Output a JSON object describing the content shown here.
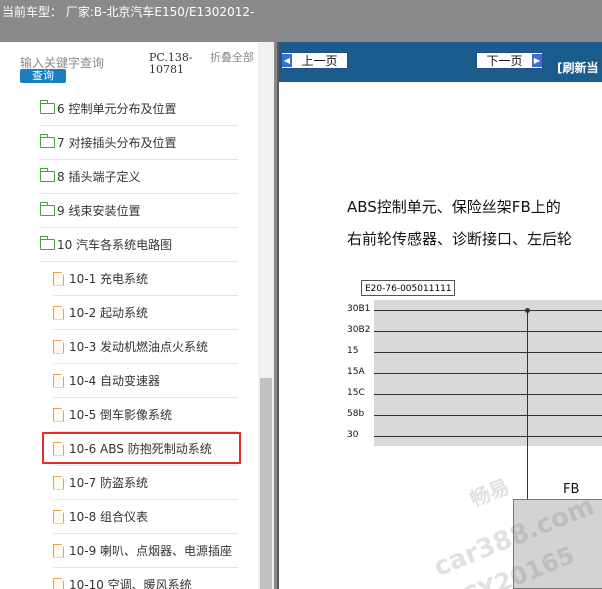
{
  "header": {
    "title": "当前车型： 厂家:B-北京汽车E150/E1302012-"
  },
  "sidebar": {
    "search_placeholder": "输入关键字查询",
    "search_button": "查询",
    "pc_code": "PC.138-10781",
    "collapse_all": "折叠全部",
    "items": [
      {
        "label": "6 控制单元分布及位置",
        "type": "folder"
      },
      {
        "label": "7 对接插头分布及位置",
        "type": "folder"
      },
      {
        "label": "8 插头端子定义",
        "type": "folder"
      },
      {
        "label": "9 线束安装位置",
        "type": "folder"
      },
      {
        "label": "10 汽车各系统电路图",
        "type": "folder-open"
      },
      {
        "label": "10-1 充电系统",
        "type": "doc"
      },
      {
        "label": "10-2 起动系统",
        "type": "doc"
      },
      {
        "label": "10-3 发动机燃油点火系统",
        "type": "doc"
      },
      {
        "label": "10-4 自动变速器",
        "type": "doc"
      },
      {
        "label": "10-5 倒车影像系统",
        "type": "doc"
      },
      {
        "label": "10-6 ABS 防抱死制动系统",
        "type": "doc",
        "selected": true
      },
      {
        "label": "10-7 防盗系统",
        "type": "doc"
      },
      {
        "label": "10-8 组合仪表",
        "type": "doc"
      },
      {
        "label": "10-9 喇叭、点烟器、电源插座",
        "type": "doc"
      },
      {
        "label": "10-10 空调、暖风系统",
        "type": "doc"
      }
    ]
  },
  "viewer": {
    "prev_button": "上一页",
    "next_button": "下一页",
    "refresh_label": "[刷新当",
    "doc_line1": "ABS控制单元、保险丝架FB上的",
    "doc_line2": "右前轮传感器、诊断接口、左后轮",
    "diagram_code": "E20-76-005011111",
    "bus_labels": [
      "30B1",
      "30B2",
      "15",
      "15A",
      "15C",
      "58b",
      "30"
    ],
    "fb_label": "FB"
  },
  "watermark": {
    "line1": "畅易",
    "line2": "car388.com",
    "line3": "CY20165"
  },
  "colors": {
    "highlight": "#e0302c",
    "nav_bg": "#1a5c8c",
    "folder": "#44a33a",
    "doc": "#e3a34b"
  }
}
